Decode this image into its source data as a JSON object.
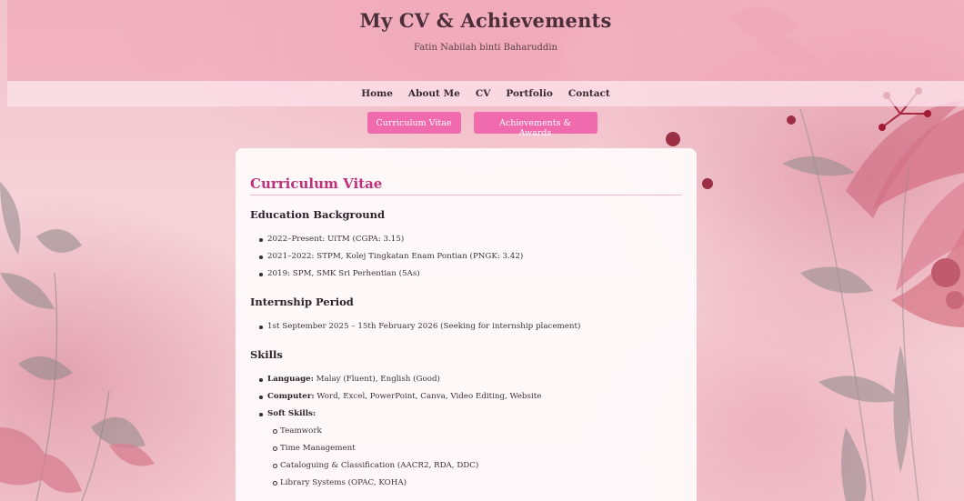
{
  "header": {
    "title": "My CV & Achievements",
    "subtitle": "Fatin Nabilah binti Baharuddin"
  },
  "nav": {
    "items": [
      "Home",
      "About Me",
      "CV",
      "Portfolio",
      "Contact"
    ]
  },
  "tabs": {
    "cv": "Curriculum Vitae",
    "awards": "Achievements & Awards"
  },
  "main": {
    "title": "Curriculum Vitae",
    "education": {
      "heading": "Education Background",
      "items": [
        "2022–Present: UiTM (CGPA: 3.15)",
        "2021–2022: STPM, Kolej Tingkatan Enam Pontian (PNGK: 3.42)",
        "2019: SPM, SMK Sri Perhentian (5As)"
      ]
    },
    "internship": {
      "heading": "Internship Period",
      "items": [
        "1st September 2025 – 15th February 2026 (Seeking for internship placement)"
      ]
    },
    "skills": {
      "heading": "Skills",
      "language_label": "Language:",
      "language_value": " Malay (Fluent), English (Good)",
      "computer_label": "Computer:",
      "computer_value": " Word, Excel, PowerPoint, Canva, Video Editing, Website",
      "soft_label": "Soft Skills:",
      "soft_items": [
        "Teamwork",
        "Time Management",
        "Cataloguing & Classification (AACR2, RDA, DDC)",
        "Library Systems (OPAC, KOHA)"
      ]
    }
  },
  "colors": {
    "accent": "#f06aae",
    "heading": "#c0307a",
    "header_band": "#f0a0b4"
  },
  "icons": [
    "floral-decoration-icon"
  ]
}
